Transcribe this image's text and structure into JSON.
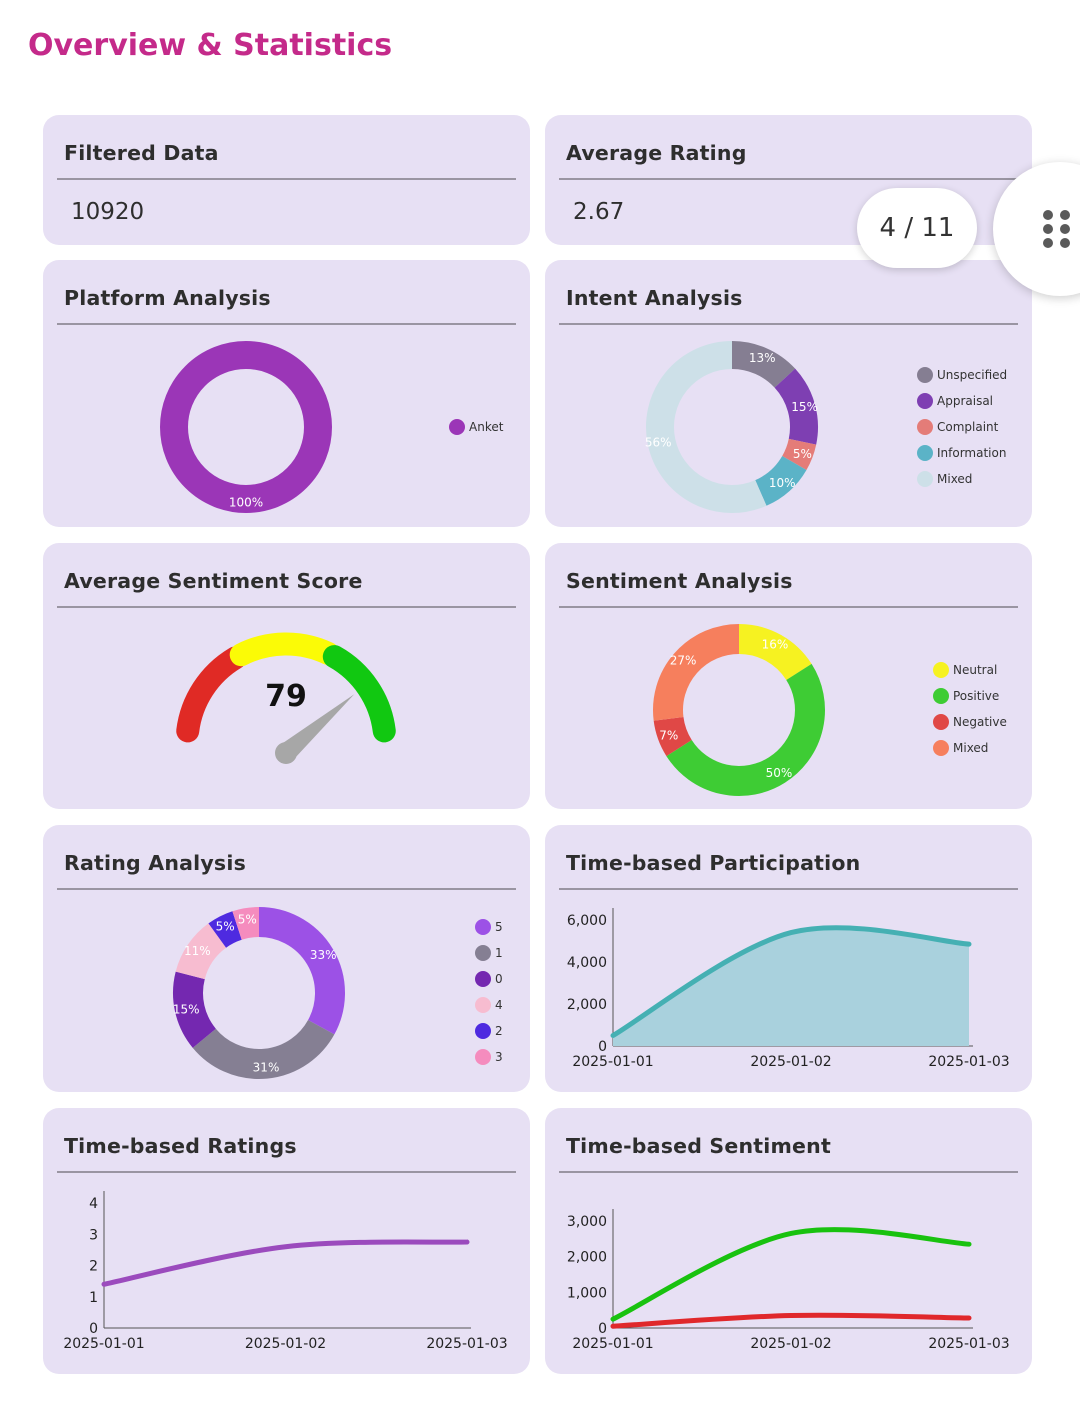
{
  "page": {
    "title": "Overview & Statistics"
  },
  "pager": {
    "text": "4 / 11"
  },
  "menu": {
    "icon": "grid-dots-icon"
  },
  "stats": {
    "filtered": {
      "title": "Filtered Data",
      "value": "10920"
    },
    "rating": {
      "title": "Average Rating",
      "value": "2.67"
    }
  },
  "cards": {
    "platform": "Platform Analysis",
    "intent": "Intent Analysis",
    "avg_sentiment": "Average Sentiment Score",
    "sentiment": "Sentiment Analysis",
    "rating": "Rating Analysis",
    "participation": "Time-based Participation",
    "ratings_time": "Time-based Ratings",
    "sentiment_time": "Time-based Sentiment"
  },
  "chart_data": [
    {
      "id": "platform",
      "type": "pie",
      "donut": true,
      "slices": [
        {
          "label": "Anket",
          "value": 100,
          "pct_label": "100%",
          "color": "#9b36b7"
        }
      ],
      "legend": "right"
    },
    {
      "id": "intent",
      "type": "pie",
      "donut": true,
      "slices": [
        {
          "label": "Unspecified",
          "value": 13,
          "pct_label": "13%",
          "color": "#857e92"
        },
        {
          "label": "Appraisal",
          "value": 15,
          "pct_label": "15%",
          "color": "#7e3fb2"
        },
        {
          "label": "Complaint",
          "value": 5,
          "pct_label": "5%",
          "color": "#e47c78"
        },
        {
          "label": "Information",
          "value": 10,
          "pct_label": "10%",
          "color": "#5bb3c7"
        },
        {
          "label": "Mixed",
          "value": 56,
          "pct_label": "56%",
          "color": "#cde0e8"
        }
      ],
      "legend": "right"
    },
    {
      "id": "avg_sentiment",
      "type": "gauge",
      "value": 79,
      "value_label": "79",
      "range": [
        0,
        100
      ],
      "bands": [
        {
          "from": 0,
          "to": 33,
          "color": "#e02a25"
        },
        {
          "from": 33,
          "to": 66,
          "color": "#fbfb06"
        },
        {
          "from": 66,
          "to": 100,
          "color": "#11c811"
        }
      ],
      "needle_color": "#a7a7a7"
    },
    {
      "id": "sentiment",
      "type": "pie",
      "donut": true,
      "slices": [
        {
          "label": "Neutral",
          "value": 16,
          "pct_label": "16%",
          "color": "#f6f221"
        },
        {
          "label": "Positive",
          "value": 50,
          "pct_label": "50%",
          "color": "#3ecc34"
        },
        {
          "label": "Negative",
          "value": 7,
          "pct_label": "7%",
          "color": "#e04846"
        },
        {
          "label": "Mixed",
          "value": 27,
          "pct_label": "27%",
          "color": "#f67f5d"
        }
      ],
      "legend": "right"
    },
    {
      "id": "rating",
      "type": "pie",
      "donut": true,
      "slices": [
        {
          "label": "5",
          "value": 33,
          "pct_label": "33%",
          "color": "#9c51e6"
        },
        {
          "label": "1",
          "value": 31,
          "pct_label": "31%",
          "color": "#857f93"
        },
        {
          "label": "0",
          "value": 15,
          "pct_label": "15%",
          "color": "#7428b0"
        },
        {
          "label": "4",
          "value": 11,
          "pct_label": "11%",
          "color": "#f7bcd0"
        },
        {
          "label": "2",
          "value": 5,
          "pct_label": "5%",
          "color": "#4e2ae0"
        },
        {
          "label": "3",
          "value": 5,
          "pct_label": "5%",
          "color": "#f58cbe"
        }
      ],
      "legend": "right"
    },
    {
      "id": "participation",
      "type": "area",
      "x": [
        "2025-01-01",
        "2025-01-02",
        "2025-01-03"
      ],
      "x_ticks": [
        "2025-01-01",
        "2025-01-02",
        "2025-01-03"
      ],
      "y_ticks": [
        "0",
        "2,000",
        "4,000",
        "6,000"
      ],
      "ylim": [
        0,
        6000
      ],
      "series": [
        {
          "values": [
            500,
            5400,
            4850
          ],
          "color": "#45b0b3",
          "fill": "#a9d1dd"
        }
      ]
    },
    {
      "id": "ratings_time",
      "type": "line",
      "x": [
        "2025-01-01",
        "2025-01-02",
        "2025-01-03"
      ],
      "x_ticks": [
        "2025-01-01",
        "2025-01-02",
        "2025-01-03"
      ],
      "y_ticks": [
        "0",
        "1",
        "2",
        "3",
        "4"
      ],
      "ylim": [
        0,
        4
      ],
      "series": [
        {
          "values": [
            1.4,
            2.6,
            2.75
          ],
          "color": "#9b4bbd"
        }
      ]
    },
    {
      "id": "sentiment_time",
      "type": "line",
      "x": [
        "2025-01-01",
        "2025-01-02",
        "2025-01-03"
      ],
      "x_ticks": [
        "2025-01-01",
        "2025-01-02",
        "2025-01-03"
      ],
      "y_ticks": [
        "0",
        "1,000",
        "2,000",
        "3,000"
      ],
      "ylim": [
        0,
        3000
      ],
      "series": [
        {
          "values": [
            250,
            2650,
            2350
          ],
          "color": "#19c20f"
        },
        {
          "values": [
            50,
            350,
            280
          ],
          "color": "#e0282b"
        }
      ]
    }
  ]
}
